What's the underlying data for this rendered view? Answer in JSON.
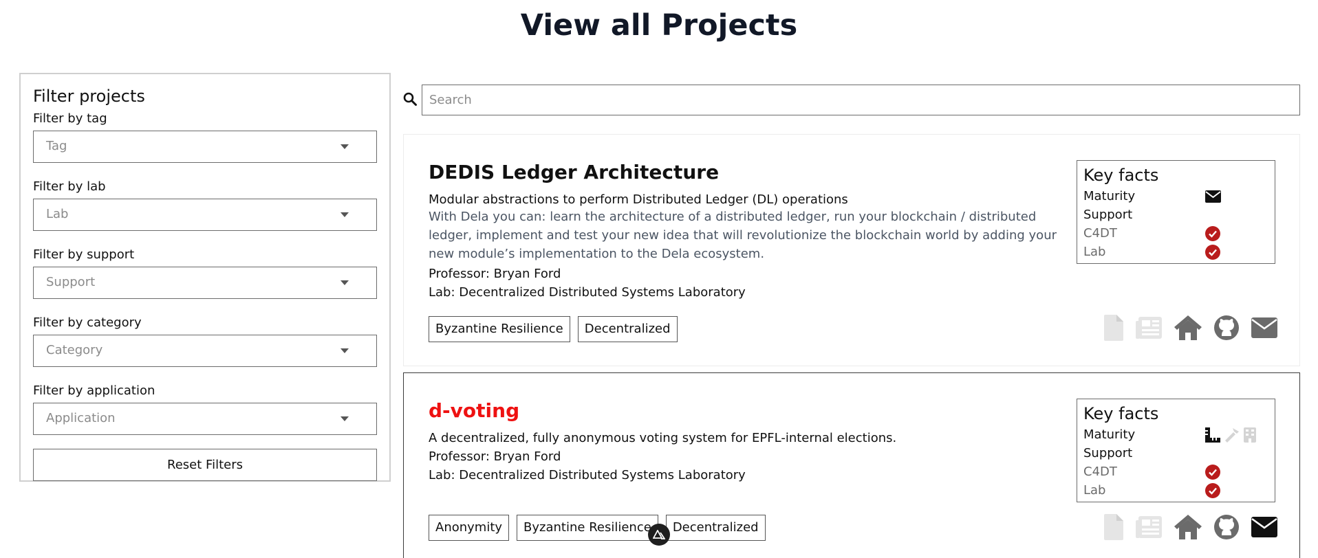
{
  "page": {
    "title": "View all Projects"
  },
  "filters": {
    "title": "Filter projects",
    "tag": {
      "label": "Filter by tag",
      "placeholder": "Tag"
    },
    "lab": {
      "label": "Filter by lab",
      "placeholder": "Lab"
    },
    "support": {
      "label": "Filter by support",
      "placeholder": "Support"
    },
    "category": {
      "label": "Filter by category",
      "placeholder": "Category"
    },
    "application": {
      "label": "Filter by application",
      "placeholder": "Application"
    },
    "reset_label": "Reset Filters"
  },
  "search": {
    "placeholder": "Search"
  },
  "projects": [
    {
      "title": "DEDIS Ledger Architecture",
      "description": "Modular abstractions to perform Distributed Ledger (DL) operations",
      "extra": "With Dela you can: learn the architecture of a distributed ledger, run your blockchain / distributed ledger, implement and test your new idea that will revolutionize the blockchain world by adding your new module’s implementation to the Dela ecosystem.",
      "professor": "Professor: Bryan Ford",
      "lab": "Lab: Decentralized Distributed Systems Laboratory",
      "tags": [
        "Byzantine Resilience",
        "Decentralized"
      ],
      "key_facts": {
        "title": "Key facts",
        "maturity": "Maturity",
        "support": "Support",
        "c4dt": "C4DT",
        "lab": "Lab"
      }
    },
    {
      "title": "d-voting",
      "description": "A decentralized, fully anonymous voting system for EPFL-internal elections.",
      "professor": "Professor: Bryan Ford",
      "lab": "Lab: Decentralized Distributed Systems Laboratory",
      "tags": [
        "Anonymity",
        "Byzantine Resilience",
        "Decentralized"
      ],
      "key_facts": {
        "title": "Key facts",
        "maturity": "Maturity",
        "support": "Support",
        "c4dt": "C4DT",
        "lab": "Lab"
      }
    }
  ],
  "colors": {
    "title": "#111827",
    "accent_red": "#ee1111",
    "check_red": "#b91c1c",
    "muted_text": "#4b5563"
  },
  "icons": [
    "search-icon",
    "chevron-down-icon",
    "envelope-icon",
    "check-circle-icon",
    "ruler-icon",
    "hammer-icon",
    "building-icon",
    "document-icon",
    "newspaper-icon",
    "home-icon",
    "github-icon",
    "nuxt-icon"
  ]
}
